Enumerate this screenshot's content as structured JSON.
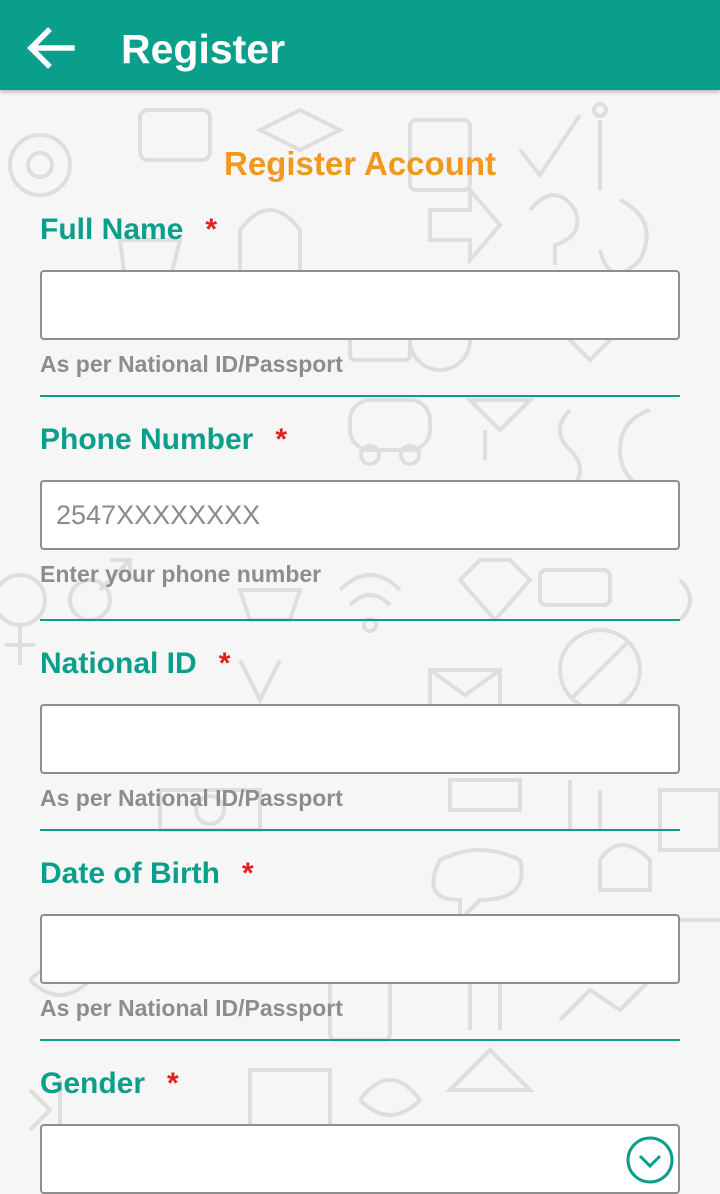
{
  "appbar": {
    "back_icon": "arrow-left-icon",
    "title": "Register"
  },
  "form": {
    "heading": "Register Account",
    "required_mark": "*",
    "fields": {
      "full_name": {
        "label": "Full Name",
        "value": "",
        "placeholder": "",
        "hint": "As per National ID/Passport"
      },
      "phone_number": {
        "label": "Phone Number",
        "value": "",
        "placeholder": "2547XXXXXXXX",
        "hint": "Enter your phone number"
      },
      "national_id": {
        "label": "National ID",
        "value": "",
        "placeholder": "",
        "hint": "As per National ID/Passport"
      },
      "date_of_birth": {
        "label": "Date of Birth",
        "value": "",
        "placeholder": "",
        "hint": "As per National ID/Passport"
      },
      "gender": {
        "label": "Gender",
        "selected": "",
        "icon": "chevron-down-circle-icon"
      }
    }
  },
  "colors": {
    "primary": "#0a9f8b",
    "accent": "#f3981e",
    "required": "#e02020",
    "hint": "#8d8d8d"
  }
}
